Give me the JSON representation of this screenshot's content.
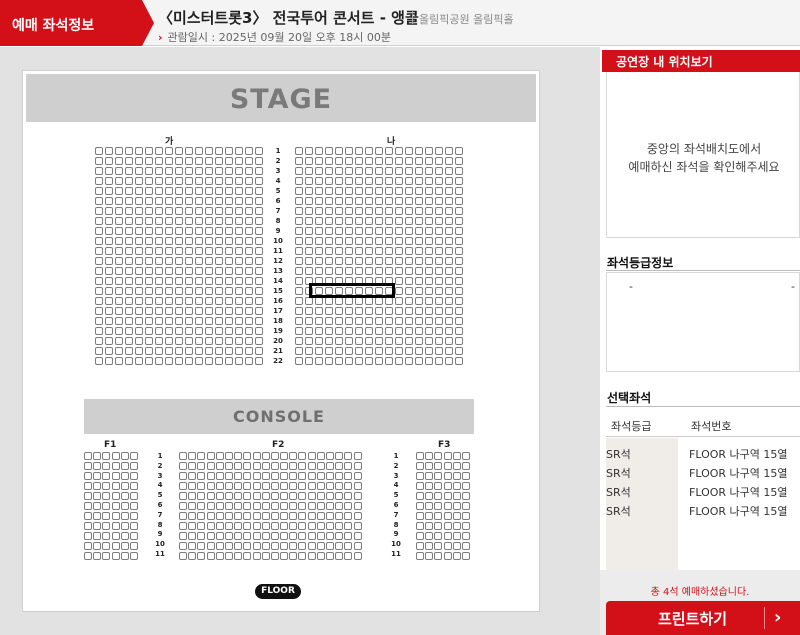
{
  "header": {
    "tab_label": "예매 좌석정보",
    "title": "〈미스터트롯3〉 전국투어 콘서트 - 앵콜",
    "venue": "올림픽공원 올림픽홀",
    "date": "관람일시 : 2025년 09월 20일 오후 18시 00분"
  },
  "map": {
    "stage_label": "STAGE",
    "console_label": "CONSOLE",
    "floor_label": "FLOOR",
    "block_ga": "가",
    "block_na": "나",
    "block_f1": "F1",
    "block_f2": "F2",
    "block_f3": "F3",
    "upper_rows": [
      "1",
      "2",
      "3",
      "4",
      "5",
      "6",
      "7",
      "8",
      "9",
      "10",
      "11",
      "12",
      "13",
      "14",
      "15",
      "16",
      "17",
      "18",
      "19",
      "20",
      "21",
      "22"
    ],
    "lower_rows": [
      "1",
      "2",
      "3",
      "4",
      "5",
      "6",
      "7",
      "8",
      "9",
      "10",
      "11"
    ]
  },
  "panel": {
    "location_title": "공연장 내 위치보기",
    "location_msg_1": "중앙의 좌석배치도에서",
    "location_msg_2": "예매하신 좌석을 확인해주세요",
    "grade_title": "좌석등급정보",
    "grade_left": "-",
    "grade_right": "-",
    "selected_title": "선택좌석",
    "col_grade": "좌석등급",
    "col_seat": "좌석번호",
    "seats": [
      {
        "grade": "SR석",
        "seat": "FLOOR 나구역 15열"
      },
      {
        "grade": "SR석",
        "seat": "FLOOR 나구역 15열"
      },
      {
        "grade": "SR석",
        "seat": "FLOOR 나구역 15열"
      },
      {
        "grade": "SR석",
        "seat": "FLOOR 나구역 15열"
      }
    ],
    "done_msg": "총 4석 예매하셨습니다.",
    "print_label": "프린트하기"
  }
}
